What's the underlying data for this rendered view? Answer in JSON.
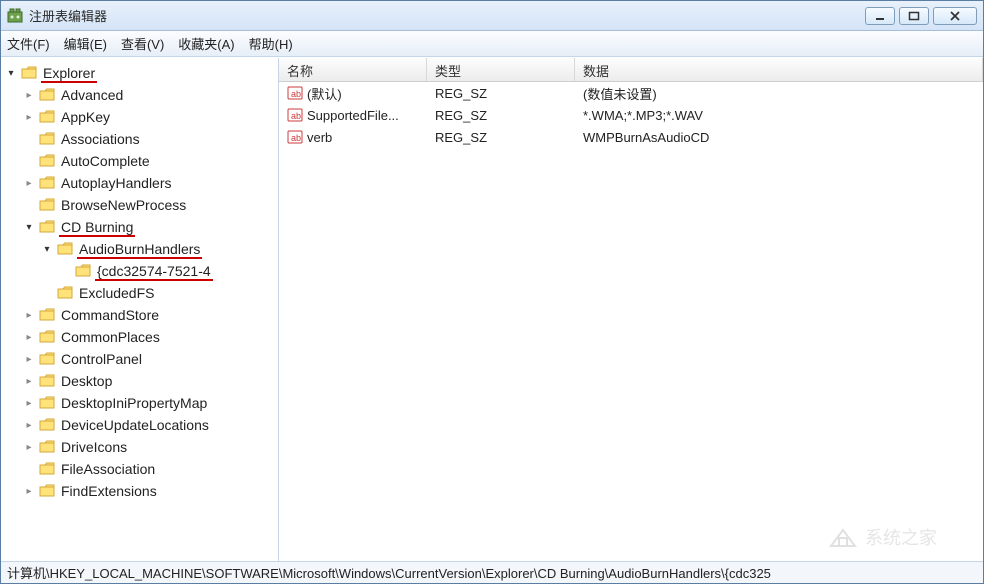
{
  "window": {
    "title": "注册表编辑器"
  },
  "menu": {
    "file": "文件(F)",
    "edit": "编辑(E)",
    "view": "查看(V)",
    "favorites": "收藏夹(A)",
    "help": "帮助(H)"
  },
  "columns": {
    "name": "名称",
    "type": "类型",
    "data": "数据"
  },
  "tree": [
    {
      "label": "Explorer",
      "state": "exp",
      "underline": true,
      "children": [
        {
          "label": "Advanced",
          "state": "col"
        },
        {
          "label": "AppKey",
          "state": "col"
        },
        {
          "label": "Associations",
          "state": "none"
        },
        {
          "label": "AutoComplete",
          "state": "none"
        },
        {
          "label": "AutoplayHandlers",
          "state": "col"
        },
        {
          "label": "BrowseNewProcess",
          "state": "none"
        },
        {
          "label": "CD Burning",
          "state": "exp",
          "underline": true,
          "children": [
            {
              "label": "AudioBurnHandlers",
              "state": "exp",
              "underline": true,
              "children": [
                {
                  "label": "{cdc32574-7521-4",
                  "state": "none",
                  "underline": true
                }
              ]
            },
            {
              "label": "ExcludedFS",
              "state": "none"
            }
          ]
        },
        {
          "label": "CommandStore",
          "state": "col"
        },
        {
          "label": "CommonPlaces",
          "state": "col"
        },
        {
          "label": "ControlPanel",
          "state": "col"
        },
        {
          "label": "Desktop",
          "state": "col"
        },
        {
          "label": "DesktopIniPropertyMap",
          "state": "col"
        },
        {
          "label": "DeviceUpdateLocations",
          "state": "col"
        },
        {
          "label": "DriveIcons",
          "state": "col"
        },
        {
          "label": "FileAssociation",
          "state": "none"
        },
        {
          "label": "FindExtensions",
          "state": "col"
        }
      ]
    }
  ],
  "values": [
    {
      "icon": "string-value",
      "name": "(默认)",
      "type": "REG_SZ",
      "data": "(数值未设置)"
    },
    {
      "icon": "string-value",
      "name": "SupportedFile...",
      "type": "REG_SZ",
      "data": "*.WMA;*.MP3;*.WAV"
    },
    {
      "icon": "string-value",
      "name": "verb",
      "type": "REG_SZ",
      "data": "WMPBurnAsAudioCD"
    }
  ],
  "status": {
    "path": "计算机\\HKEY_LOCAL_MACHINE\\SOFTWARE\\Microsoft\\Windows\\CurrentVersion\\Explorer\\CD Burning\\AudioBurnHandlers\\{cdc325"
  },
  "icons": {
    "folder": "folder-icon",
    "string": "string-value-icon"
  }
}
